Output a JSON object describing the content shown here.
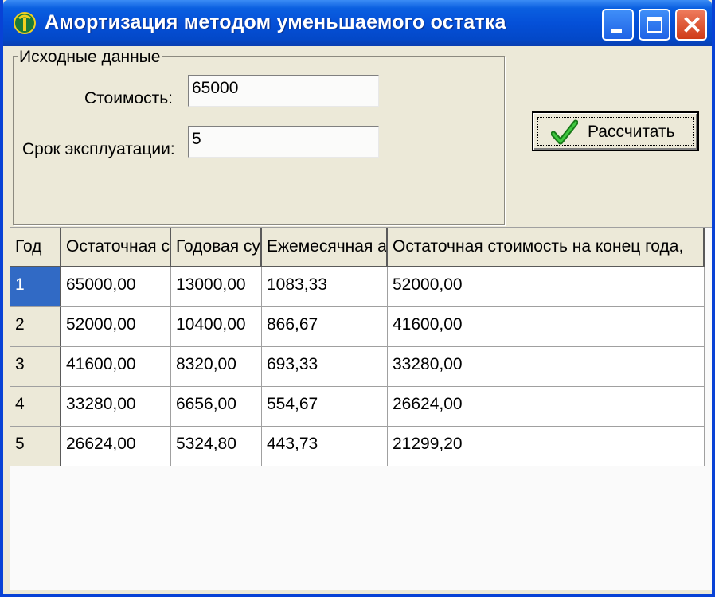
{
  "window": {
    "title": "Амортизация методом уменьшаемого остатка"
  },
  "inputs": {
    "group_title": "Исходные данные",
    "cost_label": "Стоимость:",
    "cost_value": "65000",
    "term_label": "Срок эксплуатации:",
    "term_value": "5"
  },
  "calculate_button": {
    "label": "Рассчитать",
    "icon": "checkmark-icon"
  },
  "table": {
    "columns": [
      "Год",
      "Остаточная с",
      "Годовая су",
      "Ежемесячная а",
      "Остаточная стоимость на конец года,"
    ],
    "rows": [
      [
        "1",
        "65000,00",
        "13000,00",
        "1083,33",
        "52000,00"
      ],
      [
        "2",
        "52000,00",
        "10400,00",
        "866,67",
        "41600,00"
      ],
      [
        "3",
        "41600,00",
        "8320,00",
        "693,33",
        "33280,00"
      ],
      [
        "4",
        "33280,00",
        "6656,00",
        "554,67",
        "26624,00"
      ],
      [
        "5",
        "26624,00",
        "5324,80",
        "443,73",
        "21299,20"
      ]
    ],
    "selected_cell": "1"
  },
  "colors": {
    "titlebar": "#0550d8",
    "selection": "#316ac5",
    "face": "#ece9d8"
  }
}
